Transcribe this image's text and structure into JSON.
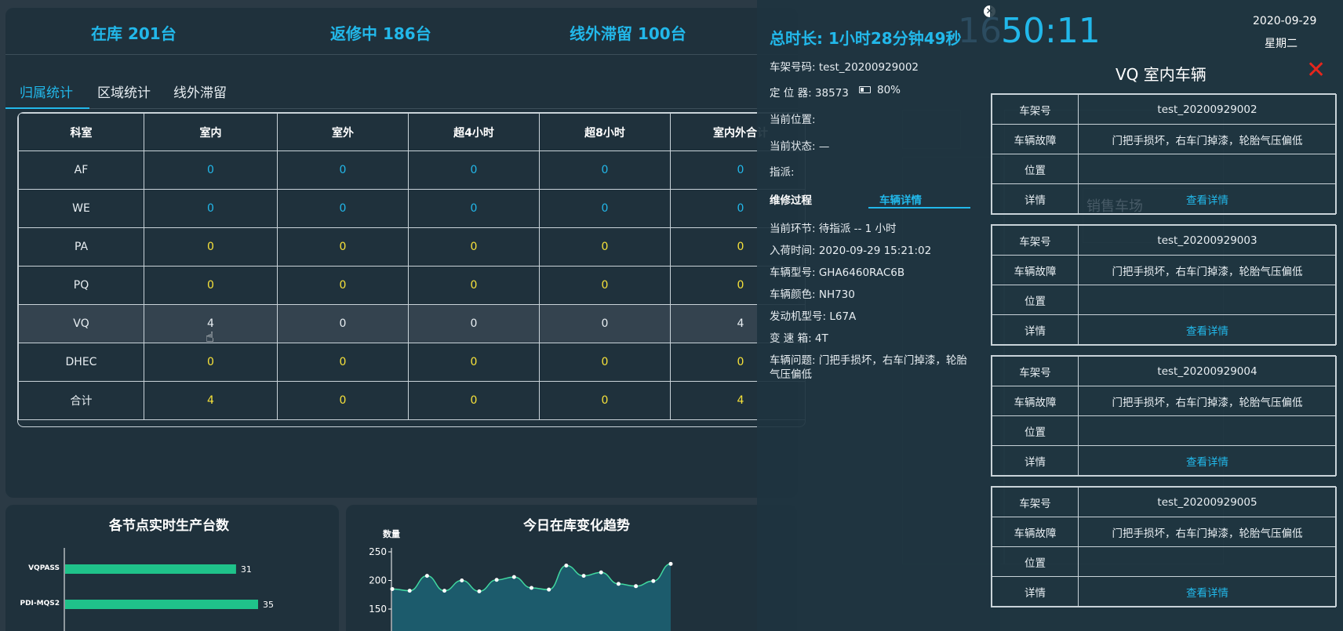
{
  "stats": {
    "in_stock": "在库 201台",
    "repairing": "返修中 186台",
    "offline": "线外滞留 100台"
  },
  "tabs": [
    "归属统计",
    "区域统计",
    "线外滞留"
  ],
  "table": {
    "headers": [
      "科室",
      "室内",
      "室外",
      "超4小时",
      "超8小时",
      "室内外合计"
    ],
    "rows": [
      {
        "name": "AF",
        "values": [
          "0",
          "0",
          "0",
          "0",
          "0"
        ]
      },
      {
        "name": "WE",
        "values": [
          "0",
          "0",
          "0",
          "0",
          "0"
        ]
      },
      {
        "name": "PA",
        "values": [
          "0",
          "0",
          "0",
          "0",
          "0"
        ]
      },
      {
        "name": "PQ",
        "values": [
          "0",
          "0",
          "0",
          "0",
          "0"
        ]
      },
      {
        "name": "VQ",
        "values": [
          "4",
          "0",
          "0",
          "0",
          "4"
        ]
      },
      {
        "name": "DHEC",
        "values": [
          "0",
          "0",
          "0",
          "0",
          "0"
        ]
      },
      {
        "name": "合计",
        "values": [
          "4",
          "0",
          "0",
          "0",
          "4"
        ]
      }
    ]
  },
  "node_card": {
    "title": "各节点实时生产台数",
    "bars": [
      {
        "label": "VQPASS",
        "value": 31
      },
      {
        "label": "PDI-MQS2",
        "value": 35
      }
    ]
  },
  "trend_card": {
    "title": "今日在库变化趋势",
    "chart_data": {
      "type": "area",
      "ylabel": "数量",
      "yticks": [
        250,
        200,
        150
      ],
      "values": [
        185,
        182,
        208,
        182,
        200,
        181,
        201,
        206,
        187,
        184,
        226,
        208,
        214,
        194,
        190,
        199,
        229
      ]
    }
  },
  "detail": {
    "duration": "总时长: 1小时28分钟49秒",
    "vin": "车架号码: test_20200929002",
    "locator_label": "定 位 器: 38573",
    "battery": "80%",
    "position": "当前位置:",
    "status": "当前状态: —",
    "assign": "指派:",
    "subtabs": [
      "维修过程",
      "车辆详情"
    ],
    "info": [
      "当前环节: 待指派 -- 1 小时",
      "入荷时间: 2020-09-29 15:21:02",
      "车辆型号: GHA6460RAC6B",
      "车辆颜色: NH730",
      "发动机型号: L67A",
      "变 速 箱: 4T"
    ],
    "problem_line1": "车辆问题: 门把手损坏，右车门掉漆，轮胎",
    "problem_line2": "气压偏低"
  },
  "clock": {
    "time": "50:11",
    "ghost": "16",
    "date": "2020-09-29",
    "weekday": "星期二"
  },
  "vq_panel": {
    "title": "VQ 室内车辆",
    "keys": [
      "车架号",
      "车辆故障",
      "位置",
      "详情"
    ],
    "link_text": "查看详情",
    "vehicles": [
      {
        "vin": "test_20200929002",
        "fault": "门把手损坏，右车门掉漆，轮胎气压偏低",
        "position": ""
      },
      {
        "vin": "test_20200929003",
        "fault": "门把手损坏，右车门掉漆，轮胎气压偏低",
        "position": ""
      },
      {
        "vin": "test_20200929004",
        "fault": "门把手损坏，右车门掉漆，轮胎气压偏低",
        "position": ""
      },
      {
        "vin": "test_20200929005",
        "fault": "门把手损坏，右车门掉漆，轮胎气压偏低",
        "position": ""
      }
    ],
    "map_label": "销售车场"
  },
  "colors": {
    "accent": "#22b8ea",
    "zero_blue": "#22b8ea",
    "zero_yellow": "#f7e23a",
    "bar": "#1fc28a",
    "area": "#1c5b6c",
    "line": "#41d8a0",
    "close_red": "#e5261d"
  }
}
